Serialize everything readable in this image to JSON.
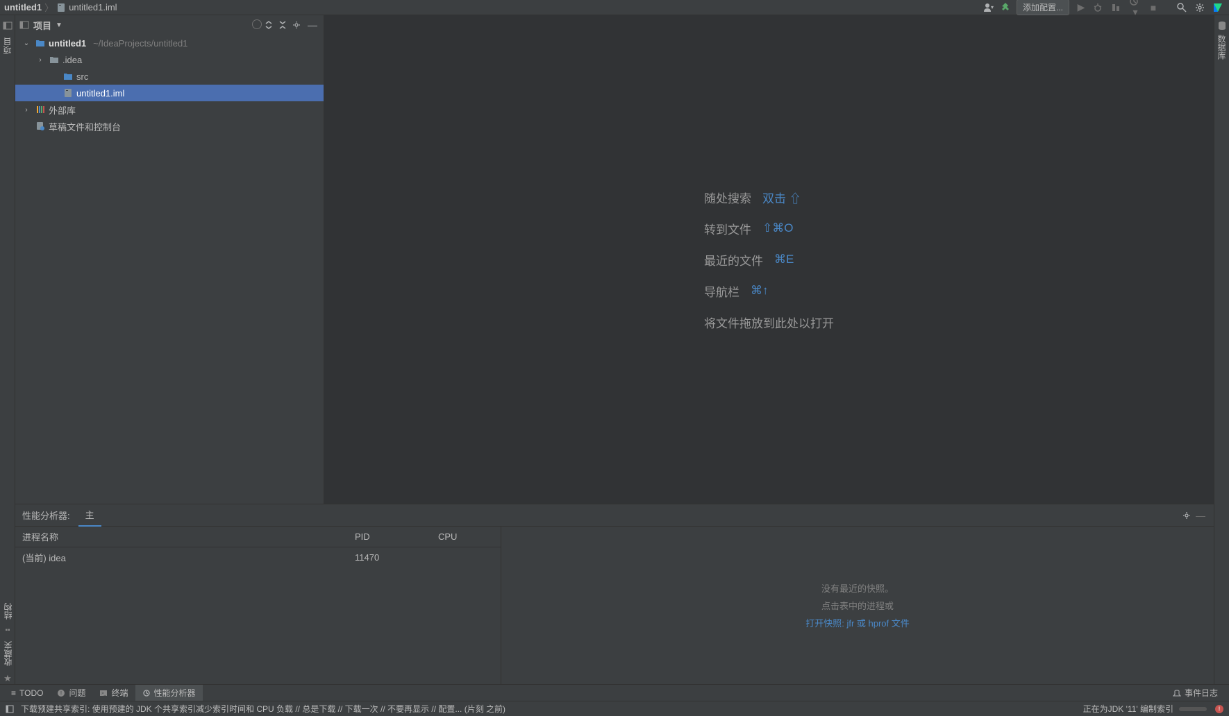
{
  "breadcrumb": {
    "project": "untitled1",
    "file": "untitled1.iml"
  },
  "toolbar": {
    "add_config": "添加配置..."
  },
  "left_gutter": {
    "project_label": "项目"
  },
  "right_gutter": {
    "database_label": "数据库"
  },
  "project_panel": {
    "title": "项目",
    "tree": {
      "root": {
        "name": "untitled1",
        "path": "~/IdeaProjects/untitled1"
      },
      "idea": ".idea",
      "src": "src",
      "iml": "untitled1.iml",
      "external_libs": "外部库",
      "scratches": "草稿文件和控制台"
    }
  },
  "editor_hints": {
    "search_everywhere": {
      "label": "随处搜索",
      "shortcut": "双击 ⇧"
    },
    "goto_file": {
      "label": "转到文件",
      "shortcut": "⇧⌘O"
    },
    "recent_files": {
      "label": "最近的文件",
      "shortcut": "⌘E"
    },
    "nav_bar": {
      "label": "导航栏",
      "shortcut": "⌘↑"
    },
    "drop_files": "将文件拖放到此处以打开"
  },
  "profiler": {
    "title": "性能分析器:",
    "tab": "主",
    "columns": {
      "name": "进程名称",
      "pid": "PID",
      "cpu": "CPU"
    },
    "rows": [
      {
        "name": "(当前) idea",
        "pid": "11470",
        "cpu": ""
      }
    ],
    "empty": {
      "line1": "没有最近的快照。",
      "line2": "点击表中的进程或",
      "link": "打开快照: jfr 或 hprof 文件"
    }
  },
  "tool_tabs": {
    "todo": "TODO",
    "problems": "问题",
    "terminal": "终端",
    "profiler": "性能分析器",
    "event_log": "事件日志"
  },
  "status": {
    "message": "下载预建共享索引: 使用预建的 JDK 个共享索引减少索引时间和 CPU 负载 // 总是下载 // 下载一次 // 不要再显示 // 配置... (片刻 之前)",
    "indexing": "正在为JDK '11' 编制索引"
  },
  "left_bottom": {
    "structure": "结构",
    "favorites": "收藏夹"
  }
}
